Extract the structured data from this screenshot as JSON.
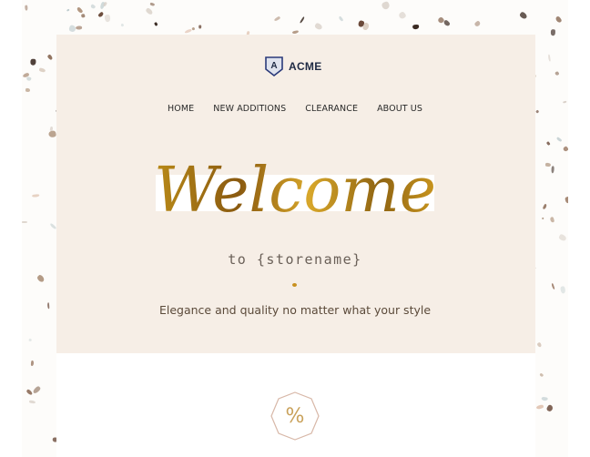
{
  "brand": {
    "logo_letter": "A",
    "name": "ACME",
    "color": "#1f2a44"
  },
  "nav": {
    "items": [
      {
        "label": "HOME"
      },
      {
        "label": "NEW ADDITIONS"
      },
      {
        "label": "CLEARANCE"
      },
      {
        "label": "ABOUT US"
      }
    ]
  },
  "hero": {
    "headline": "Welcome",
    "tagline": "to {storename}",
    "subline": "Elegance and quality no matter what your style",
    "accent_color": "#c8901f",
    "background_color": "#f6eee6"
  },
  "offer_badge": {
    "symbol": "%",
    "icon": "percent-icon",
    "color": "#c9a15a"
  }
}
